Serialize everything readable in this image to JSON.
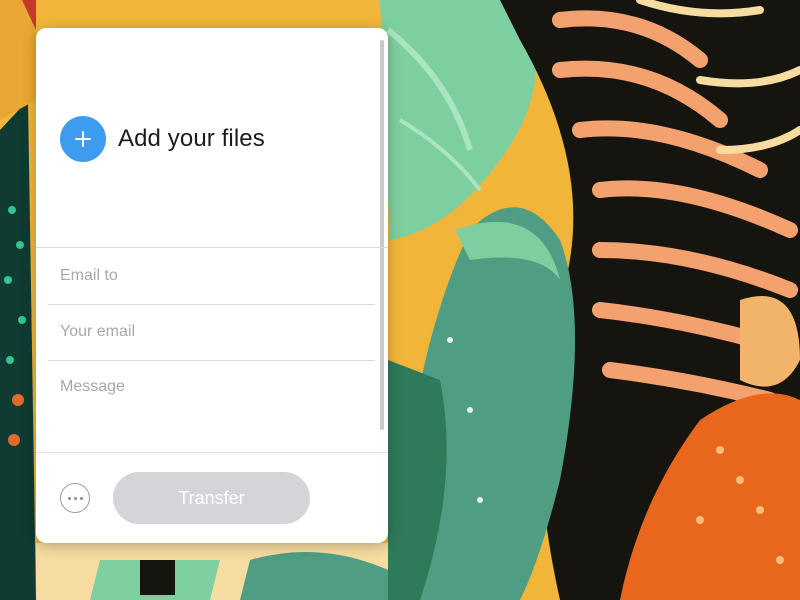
{
  "background": {
    "description_icon": "illustrated-artwork-background",
    "colors": {
      "mustard": "#f1b53a",
      "mint": "#7ecfa0",
      "sea_green": "#4f9e83",
      "black": "#15140f",
      "salmon": "#f3a16e",
      "cream": "#f6dca0",
      "orange": "#e8671c"
    }
  },
  "uploader": {
    "add_files_label": "Add your files",
    "add_icon": "plus-icon",
    "accent_color": "#3d9cf0",
    "fields": {
      "email_to_placeholder": "Email to",
      "your_email_placeholder": "Your email",
      "message_placeholder": "Message"
    },
    "more_icon": "more-options-icon",
    "transfer_label": "Transfer",
    "transfer_color": "#d4d5d8"
  }
}
